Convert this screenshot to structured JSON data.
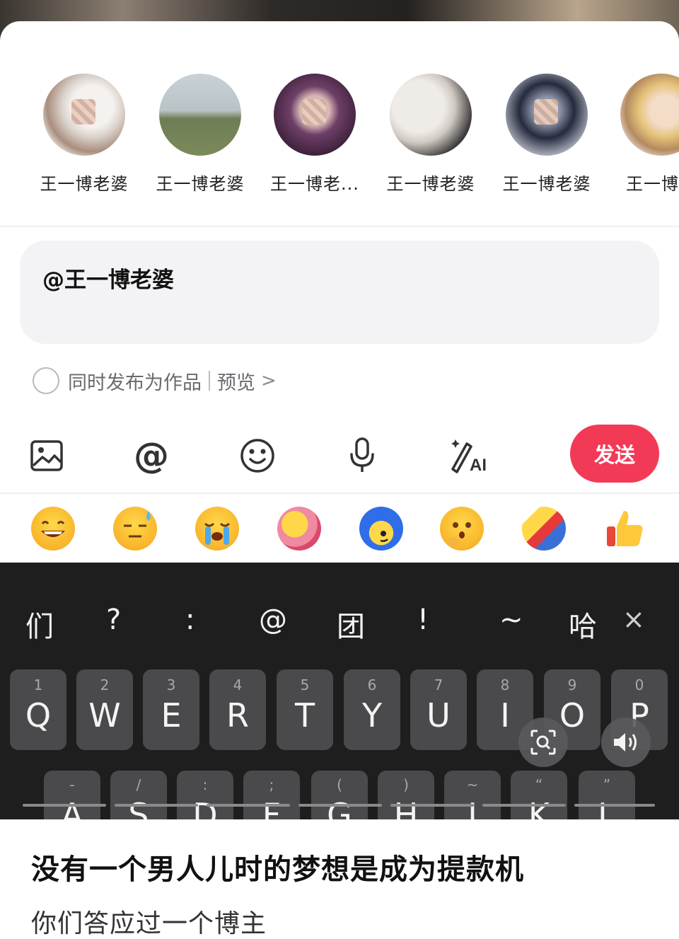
{
  "mentions": [
    {
      "name": "王一博老婆"
    },
    {
      "name": "王一博老婆"
    },
    {
      "name": "王一博老..."
    },
    {
      "name": "王一博老婆"
    },
    {
      "name": "王一博老婆"
    },
    {
      "name": "王一博老"
    }
  ],
  "input": {
    "value": "@王一博老婆"
  },
  "publish": {
    "label": "同时发布为作品",
    "preview": "预览",
    "chevron": ">"
  },
  "toolbar": {
    "icons": [
      "image-icon",
      "at-icon",
      "emoji-face-icon",
      "microphone-icon",
      "ai-write-icon"
    ],
    "at_glyph": "@",
    "ai_glyph": "AI",
    "send_label": "发送",
    "send_color": "#f23a56"
  },
  "emojis": [
    "grinning",
    "sweat",
    "crying",
    "hug",
    "blue-hair",
    "thinking",
    "flying",
    "thumbs-up"
  ],
  "keyboard": {
    "candidates": [
      "们",
      "?",
      ":",
      "@",
      "团",
      "!",
      "~",
      "哈"
    ],
    "close": "×",
    "row1": [
      {
        "num": "1",
        "letter": "Q"
      },
      {
        "num": "2",
        "letter": "W"
      },
      {
        "num": "3",
        "letter": "E"
      },
      {
        "num": "4",
        "letter": "R"
      },
      {
        "num": "5",
        "letter": "T"
      },
      {
        "num": "6",
        "letter": "Y"
      },
      {
        "num": "7",
        "letter": "U"
      },
      {
        "num": "8",
        "letter": "I"
      },
      {
        "num": "9",
        "letter": "O"
      },
      {
        "num": "0",
        "letter": "P"
      }
    ],
    "row2": [
      {
        "sym": "-",
        "letter": "A"
      },
      {
        "sym": "/",
        "letter": "S"
      },
      {
        "sym": ":",
        "letter": "D"
      },
      {
        "sym": ";",
        "letter": "F"
      },
      {
        "sym": "(",
        "letter": "G"
      },
      {
        "sym": ")",
        "letter": "H"
      },
      {
        "sym": "~",
        "letter": "J"
      },
      {
        "sym": "“",
        "letter": "K"
      },
      {
        "sym": "”",
        "letter": "L"
      }
    ]
  },
  "caption": {
    "title": "没有一个男人儿时的梦想是成为提款机",
    "subtitle": "你们答应过一个博主"
  }
}
